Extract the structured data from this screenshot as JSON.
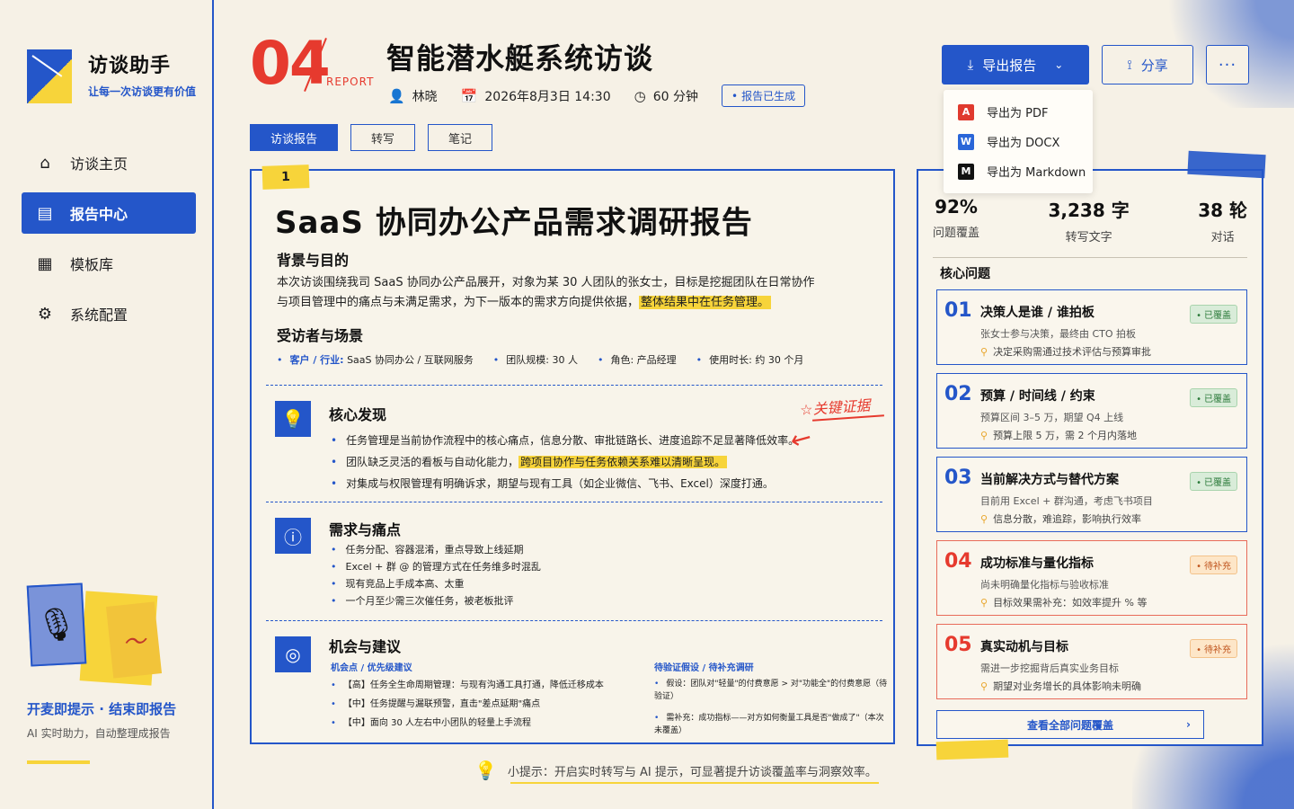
{
  "app": {
    "name": "访谈助手",
    "tagline": "让每一次访谈更有价值"
  },
  "nav": [
    {
      "label": "访谈主页",
      "icon": "home-icon",
      "glyph": "⌂",
      "active": false
    },
    {
      "label": "报告中心",
      "icon": "document-icon",
      "glyph": "▤",
      "active": true
    },
    {
      "label": "模板库",
      "icon": "grid-icon",
      "glyph": "▦",
      "active": false
    },
    {
      "label": "系统配置",
      "icon": "gear-icon",
      "glyph": "⚙",
      "active": false
    }
  ],
  "promo": {
    "title": "开麦即提示 · 结束即报告",
    "subtitle": "AI 实时助力，自动整理成报告"
  },
  "header": {
    "number": "04",
    "report_tag": "REPORT",
    "title": "智能潜水艇系统访谈",
    "interviewer": "林晓",
    "datetime": "2026年8月3日 14:30",
    "duration": "60 分钟",
    "status": "报告已生成"
  },
  "actions": {
    "export_label": "导出报告",
    "share_label": "分享",
    "more_label": "···",
    "export_menu": [
      {
        "label": "导出为 PDF",
        "icon": "pdf-icon",
        "glyph": "A"
      },
      {
        "label": "导出为 DOCX",
        "icon": "docx-icon",
        "glyph": "W"
      },
      {
        "label": "导出为 Markdown",
        "icon": "markdown-icon",
        "glyph": "M"
      }
    ]
  },
  "tabs": [
    {
      "label": "访谈报告",
      "active": true
    },
    {
      "label": "转写",
      "active": false
    },
    {
      "label": "笔记",
      "active": false
    }
  ],
  "report": {
    "flag": "1",
    "title": "SaaS 协同办公产品需求调研报告",
    "background": {
      "heading": "背景与目的",
      "text_part1": "本次访谈围绕我司 SaaS 协同办公产品展开，对象为某 30 人团队的张女士，目标是挖掘团队在日常协作",
      "text_part2": "与项目管理中的痛点与未满足需求，为下一版本的需求方向提供依据，",
      "highlight": "整体结果中在任务管理。"
    },
    "scene": {
      "heading": "受访者与场景",
      "items": [
        {
          "key": "客户 / 行业:",
          "value": "SaaS 协同办公 / 互联网服务"
        },
        {
          "key": "团队规模:",
          "value": "30 人"
        },
        {
          "key": "角色:",
          "value": "产品经理"
        },
        {
          "key": "使用时长:",
          "value": "约 30 个月"
        }
      ]
    },
    "findings": {
      "heading": "核心发现",
      "b1": "任务管理是当前协作流程中的核心痛点，信息分散、审批链路长、进度追踪不足显著降低效率。",
      "b2_pre": "团队缺乏灵活的看板与自动化能力，",
      "b2_hl": "跨项目协作与任务依赖关系难以清晰呈现。",
      "b3": "对集成与权限管理有明确诉求，期望与现有工具（如企业微信、飞书、Excel）深度打通。"
    },
    "annotation": "☆关键证据",
    "needs": {
      "heading": "需求与痛点",
      "items": [
        "任务分配、容器混淆，重点导致上线延期",
        "Excel + 群 @ 的管理方式在任务维多时混乱",
        "现有竞品上手成本高、太重",
        "一个月至少需三次催任务，被老板批评"
      ]
    },
    "opportunities": {
      "heading": "机会与建议",
      "left_label": "机会点 / 优先级建议",
      "left_items": [
        "【高】任务全生命周期管理：与现有沟通工具打通，降低迁移成本",
        "【中】任务提醒与漏联预警，直击\"差点延期\"痛点",
        "【中】面向 30 人左右中小团队的轻量上手流程"
      ],
      "right_label": "待验证假设 / 待补充调研",
      "right_items": [
        "假设：团队对\"轻量\"的付费意愿 > 对\"功能全\"的付费意愿（待验证）",
        "需补充：成功指标——对方如何衡量工具是否\"做成了\"（本次未覆盖）"
      ]
    }
  },
  "tip": "小提示：开启实时转写与 AI 提示，可显著提升访谈覆盖率与洞察效率。",
  "panel": {
    "stats": [
      {
        "value": "92%",
        "label": "问题覆盖"
      },
      {
        "value": "3,238 字",
        "label": "转写文字"
      },
      {
        "value": "38 轮",
        "label": "对话"
      }
    ],
    "heading": "核心问题",
    "questions": [
      {
        "num": "01",
        "title": "决策人是谁 / 谁拍板",
        "desc": "张女士参与决策，最终由 CTO 拍板",
        "evidence": "决定采购需通过技术评估与预算审批",
        "status": "已覆盖",
        "state": "ok"
      },
      {
        "num": "02",
        "title": "预算 / 时间线 / 约束",
        "desc": "预算区间 3–5 万，期望 Q4 上线",
        "evidence": "预算上限 5 万，需 2 个月内落地",
        "status": "已覆盖",
        "state": "ok"
      },
      {
        "num": "03",
        "title": "当前解决方式与替代方案",
        "desc": "目前用 Excel + 群沟通，考虑飞书项目",
        "evidence": "信息分散，难追踪，影响执行效率",
        "status": "已覆盖",
        "state": "ok"
      },
      {
        "num": "04",
        "title": "成功标准与量化指标",
        "desc": "尚未明确量化指标与验收标准",
        "evidence": "目标效果需补充：如效率提升 % 等",
        "status": "待补充",
        "state": "todo"
      },
      {
        "num": "05",
        "title": "真实动机与目标",
        "desc": "需进一步挖掘背后真实业务目标",
        "evidence": "期望对业务增长的具体影响未明确",
        "status": "待补充",
        "state": "todo"
      }
    ],
    "view_all": "查看全部问题覆盖"
  },
  "colors": {
    "accent": "#2456c9",
    "highlight": "#f7d43a",
    "alert": "#e63a2e",
    "background": "#f6f1e6"
  }
}
